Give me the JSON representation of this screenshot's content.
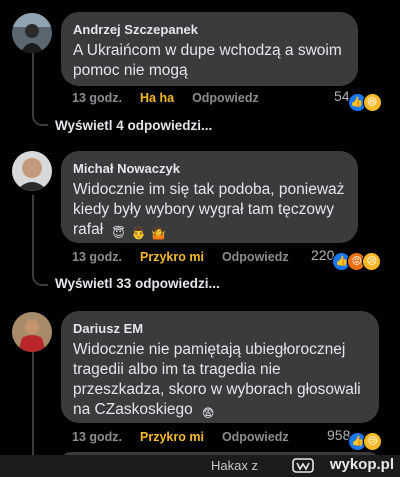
{
  "comments": [
    {
      "author": "Andrzej Szczepanek",
      "text": "A Ukraińcom w dupe wchodzą a swoim pomoc nie mogą",
      "time": "13 godz.",
      "reaction": "Ha ha",
      "reply": "Odpowiedz",
      "count": "54",
      "reaction_icons": [
        "like",
        "haha"
      ],
      "view_replies": "Wyświetl 4 odpowiedzi..."
    },
    {
      "author": "Michał Nowaczyk",
      "text": "Widocznie im się tak podoba, ponieważ kiedy były wybory wygrał tam tęczowy rafał",
      "text_emojis": [
        "angel-emoji",
        "man-emoji",
        "shrug-emoji"
      ],
      "time": "13 godz.",
      "reaction": "Przykro mi",
      "reply": "Odpowiedz",
      "count": "220",
      "reaction_icons": [
        "like",
        "angry",
        "sad"
      ],
      "view_replies": "Wyświetl 33 odpowiedzi..."
    },
    {
      "author": "Dariusz EM",
      "text": "Widocznie nie pamiętają ubiegłorocznej tragedii albo im ta tragedia nie przeszkadza, skoro w wyborach głosowali na CZaskoskiego",
      "text_emojis": [
        "fearful-face-emoji"
      ],
      "time": "13 godz.",
      "reaction": "Przykro mi",
      "reply": "Odpowiedz",
      "count": "958",
      "reaction_icons": [
        "like",
        "sad"
      ]
    }
  ],
  "footer": {
    "user": "Hakax",
    "separator": "z",
    "site": "wykop.pl"
  },
  "colors": {
    "bubble": "#3a3b3c",
    "background": "#000000",
    "reaction_active": "#f7b928",
    "meta": "#8a8d91"
  }
}
